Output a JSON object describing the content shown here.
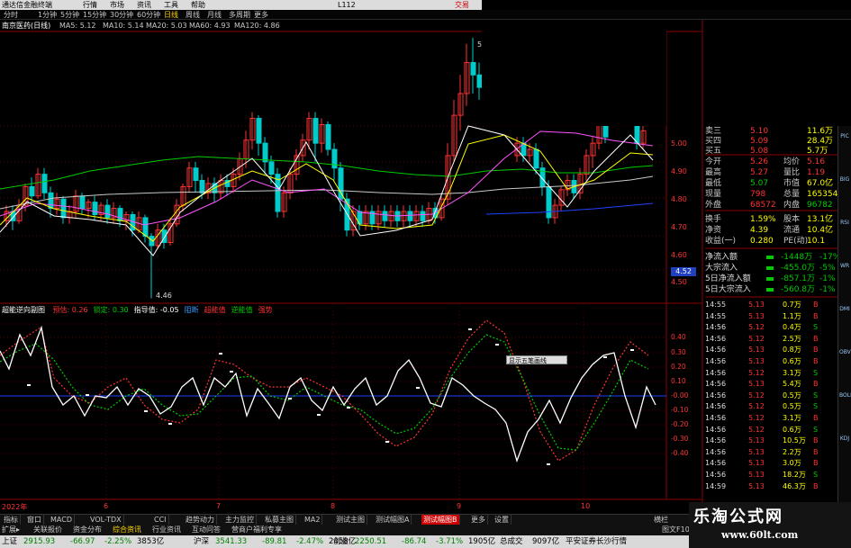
{
  "menu": {
    "app_title": "通达信金融终端",
    "items": [
      "行情",
      "市场",
      "资讯",
      "工具",
      "帮助",
      "L112"
    ],
    "login": "交易"
  },
  "toolbar": {
    "periods": [
      "分时",
      "1分钟",
      "5分钟",
      "15分钟",
      "30分钟",
      "60分钟",
      "日线",
      "周线",
      "月线",
      "多周期",
      "更多"
    ],
    "selected": "日线"
  },
  "main_chart": {
    "stock": "南京医药(日线)",
    "ma": [
      {
        "label": "MA5: 5.12",
        "color": "#ffffff"
      },
      {
        "label": "MA10: 5.14",
        "color": "#ffff00"
      },
      {
        "label": "MA20: 5.03",
        "color": "#ff55ff"
      },
      {
        "label": "MA60: 4.93",
        "color": "#00ff00"
      },
      {
        "label": "MA120: 4.86",
        "color": "#c8c8c8"
      }
    ],
    "high_label": "5",
    "low_label": "4.46",
    "price_axis": [
      "5.00",
      "4.90",
      "4.80",
      "4.70",
      "4.60",
      "4.50"
    ],
    "current_price": "4.52"
  },
  "indicator": {
    "title": "超能逆向副图",
    "legend": [
      {
        "label": "预估: 0.26",
        "color": "#ff3333"
      },
      {
        "label": "锁定: 0.30",
        "color": "#00cc00"
      },
      {
        "label": "指导值: -0.05",
        "color": "#ffffff"
      },
      {
        "label": "阻断",
        "color": "#3399ff"
      },
      {
        "label": "超能值",
        "color": "#ff3333"
      },
      {
        "label": "逆能值",
        "color": "#00cc00"
      },
      {
        "label": "强势",
        "color": "#ff3333"
      }
    ],
    "axis": [
      "0.40",
      "0.30",
      "0.20",
      "0.10",
      "-0.00",
      "-0.10",
      "-0.20",
      "-0.30",
      "-0.40"
    ],
    "tooltip": "显示五笔画线"
  },
  "quote_panel": {
    "rows": [
      {
        "a": "卖三",
        "b": "5.10",
        "c": "11.6万",
        "bc": "#ff3333",
        "cc": "#ffff00"
      },
      {
        "a": "买四",
        "b": "5.09",
        "c": "28.4万",
        "bc": "#ff3333",
        "cc": "#ffff00"
      },
      {
        "a": "买五",
        "b": "5.08",
        "c": "5.7万",
        "bc": "#ff3333",
        "cc": "#ffff00"
      },
      {
        "a": "今开",
        "b": "5.26",
        "c": "均价",
        "d": "5.16",
        "bc": "#ff3333",
        "dc": "#ff3333"
      },
      {
        "a": "最高",
        "b": "5.27",
        "c": "量比",
        "d": "1.19",
        "bc": "#ff3333",
        "dc": "#ff3333"
      },
      {
        "a": "最低",
        "b": "5.07",
        "c": "市值",
        "d": "67.0亿",
        "bc": "#00cc00",
        "dc": "#ffff00"
      },
      {
        "a": "现量",
        "b": "798",
        "c": "总量",
        "d": "165354",
        "bc": "#ff3333",
        "dc": "#ffff00"
      },
      {
        "a": "外盘",
        "b": "68572",
        "c": "内盘",
        "d": "96782",
        "bc": "#ff3333",
        "dc": "#00cc00"
      },
      {
        "a": "换手",
        "b": "1.59%",
        "c": "股本",
        "d": "13.1亿",
        "bc": "#ffff00",
        "dc": "#ffff00"
      },
      {
        "a": "净资",
        "b": "4.39",
        "c": "流通",
        "d": "10.4亿",
        "bc": "#ffff00",
        "dc": "#ffff00"
      },
      {
        "a": "收益(一)",
        "b": "0.280",
        "c": "PE(动)",
        "d": "10.1",
        "bc": "#ffff00",
        "dc": "#ffff00"
      }
    ],
    "flow": [
      {
        "label": "净流入额",
        "value": "-1448万",
        "pct": "-17%"
      },
      {
        "label": "大宗流入",
        "value": "-455.0万",
        "pct": "-5%"
      },
      {
        "label": "5日净流入额",
        "value": "-857.1万",
        "pct": "-1%"
      },
      {
        "label": "5日大宗流入",
        "value": "-560.8万",
        "pct": "-1%"
      }
    ]
  },
  "ticks": [
    {
      "t": "14:55",
      "p": "5.13",
      "v": "0.7万",
      "s": "B"
    },
    {
      "t": "14:55",
      "p": "5.13",
      "v": "1.1万",
      "s": "B"
    },
    {
      "t": "14:56",
      "p": "5.12",
      "v": "0.4万",
      "s": "S"
    },
    {
      "t": "14:56",
      "p": "5.12",
      "v": "2.5万",
      "s": "B"
    },
    {
      "t": "14:56",
      "p": "5.13",
      "v": "0.8万",
      "s": "B"
    },
    {
      "t": "14:56",
      "p": "5.13",
      "v": "0.6万",
      "s": "B"
    },
    {
      "t": "14:56",
      "p": "5.12",
      "v": "3.1万",
      "s": "S"
    },
    {
      "t": "14:56",
      "p": "5.13",
      "v": "5.4万",
      "s": "B"
    },
    {
      "t": "14:56",
      "p": "5.12",
      "v": "0.5万",
      "s": "S"
    },
    {
      "t": "14:56",
      "p": "5.12",
      "v": "0.5万",
      "s": "S"
    },
    {
      "t": "14:56",
      "p": "5.12",
      "v": "3.1万",
      "s": "B"
    },
    {
      "t": "14:56",
      "p": "5.12",
      "v": "0.6万",
      "s": "S"
    },
    {
      "t": "14:56",
      "p": "5.13",
      "v": "10.5万",
      "s": "B"
    },
    {
      "t": "14:56",
      "p": "5.13",
      "v": "2.2万",
      "s": "B"
    },
    {
      "t": "14:56",
      "p": "5.13",
      "v": "3.0万",
      "s": "B"
    },
    {
      "t": "14:56",
      "p": "5.13",
      "v": "18.2万",
      "s": "S"
    },
    {
      "t": "14:59",
      "p": "5.13",
      "v": "46.3万",
      "s": "B"
    }
  ],
  "date_axis": [
    "2022年",
    "6",
    "7",
    "8",
    "9",
    "10"
  ],
  "bottom_tabs": [
    "指标",
    "窗口",
    "MACD",
    "VOL-TDX",
    "CCI",
    "趋势动力",
    "主力监控",
    "私募主图",
    "MA2",
    "测试主图",
    "测试幅图A",
    "测试幅图B",
    "更多",
    "设置"
  ],
  "bottom_tabs_selected": "测试幅图B",
  "status1": [
    "扩展▸",
    "关联报价",
    "资金分布",
    "综合资讯",
    "行业资讯",
    "互动问答",
    "营商户福利专享"
  ],
  "status1_right": "图文F10",
  "status2": [
    {
      "label": "上证",
      "value": "2915.93",
      "chg": "-66.97",
      "pct": "-2.25%",
      "vol": "3853亿"
    },
    {
      "label": "沪深",
      "value": "3541.33",
      "chg": "-89.81",
      "pct": "-2.47%",
      "vol": "2458亿"
    },
    {
      "label": "创业",
      "value": "2250.51",
      "chg": "-86.74",
      "pct": "-3.71%",
      "vol": "1905亿"
    }
  ],
  "status2_total_label": "总成交",
  "status2_total": "9097亿",
  "status2_broker": "平安证券长沙行情",
  "watermark": {
    "title": "乐淘公式网",
    "url": "www.60lt.com"
  },
  "right_icons": [
    "PIC",
    "BIG",
    "RSI",
    "WR",
    "DMI",
    "OBV",
    "BOLL",
    "KDJ"
  ],
  "side_label": "横栏",
  "colors": {
    "up": "#ff3333",
    "down": "#00cccc",
    "grid": "#8b0000"
  }
}
